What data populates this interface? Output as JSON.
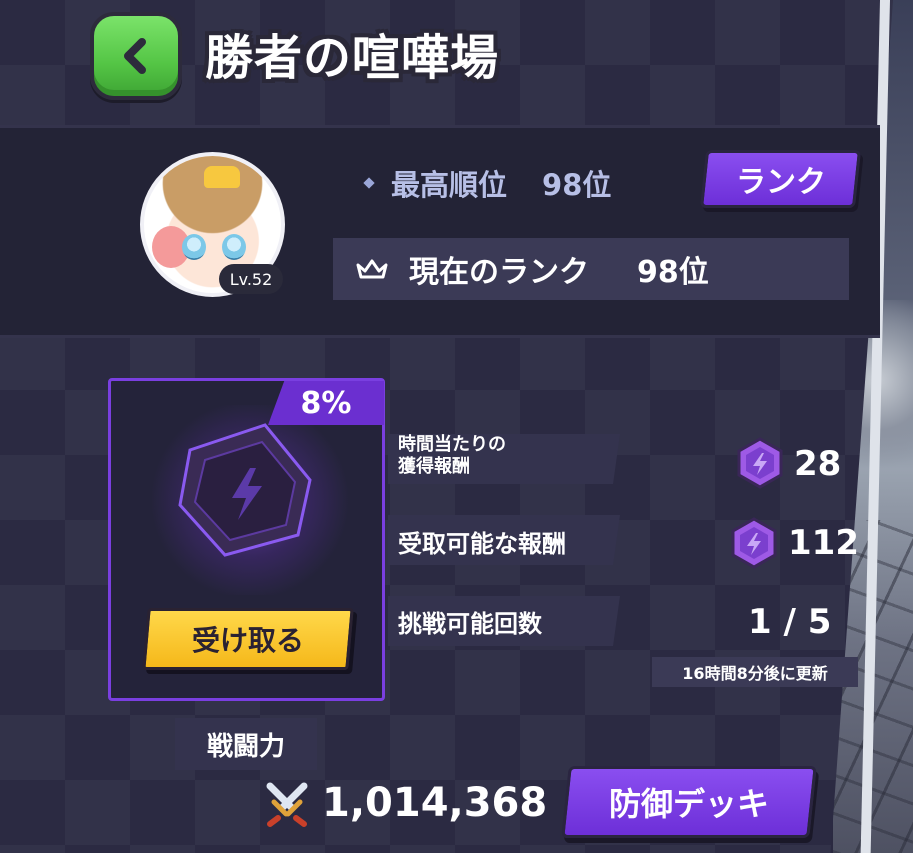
{
  "header": {
    "title": "勝者の喧嘩場"
  },
  "profile": {
    "level": "Lv.52",
    "best_rank_label": "最高順位",
    "best_rank_value": "98位",
    "rank_button": "ランク",
    "current_rank_label": "現在のランク",
    "current_rank_value": "98位"
  },
  "reward_card": {
    "percent": "8%",
    "progress_fraction": 0.08,
    "claim_button": "受け取る"
  },
  "stats": {
    "hourly_label_line1": "時間当たりの",
    "hourly_label_line2": "獲得報酬",
    "hourly_value": "28",
    "claimable_label": "受取可能な報酬",
    "claimable_value": "112",
    "attempts_label": "挑戦可能回数",
    "attempts_value": "1 / 5",
    "refresh_note": "16時間8分後に更新"
  },
  "combat": {
    "power_label": "戦闘力",
    "power_value": "1,014,368",
    "defense_button": "防御デッキ"
  },
  "colors": {
    "accent_purple": "#7a3fe0",
    "back_green": "#54c545",
    "claim_yellow": "#f5b81a"
  },
  "icons": [
    "chevron-left-icon",
    "diamond-bullet-icon",
    "crown-icon",
    "hexagon-gem-icon",
    "crossed-swords-icon"
  ]
}
